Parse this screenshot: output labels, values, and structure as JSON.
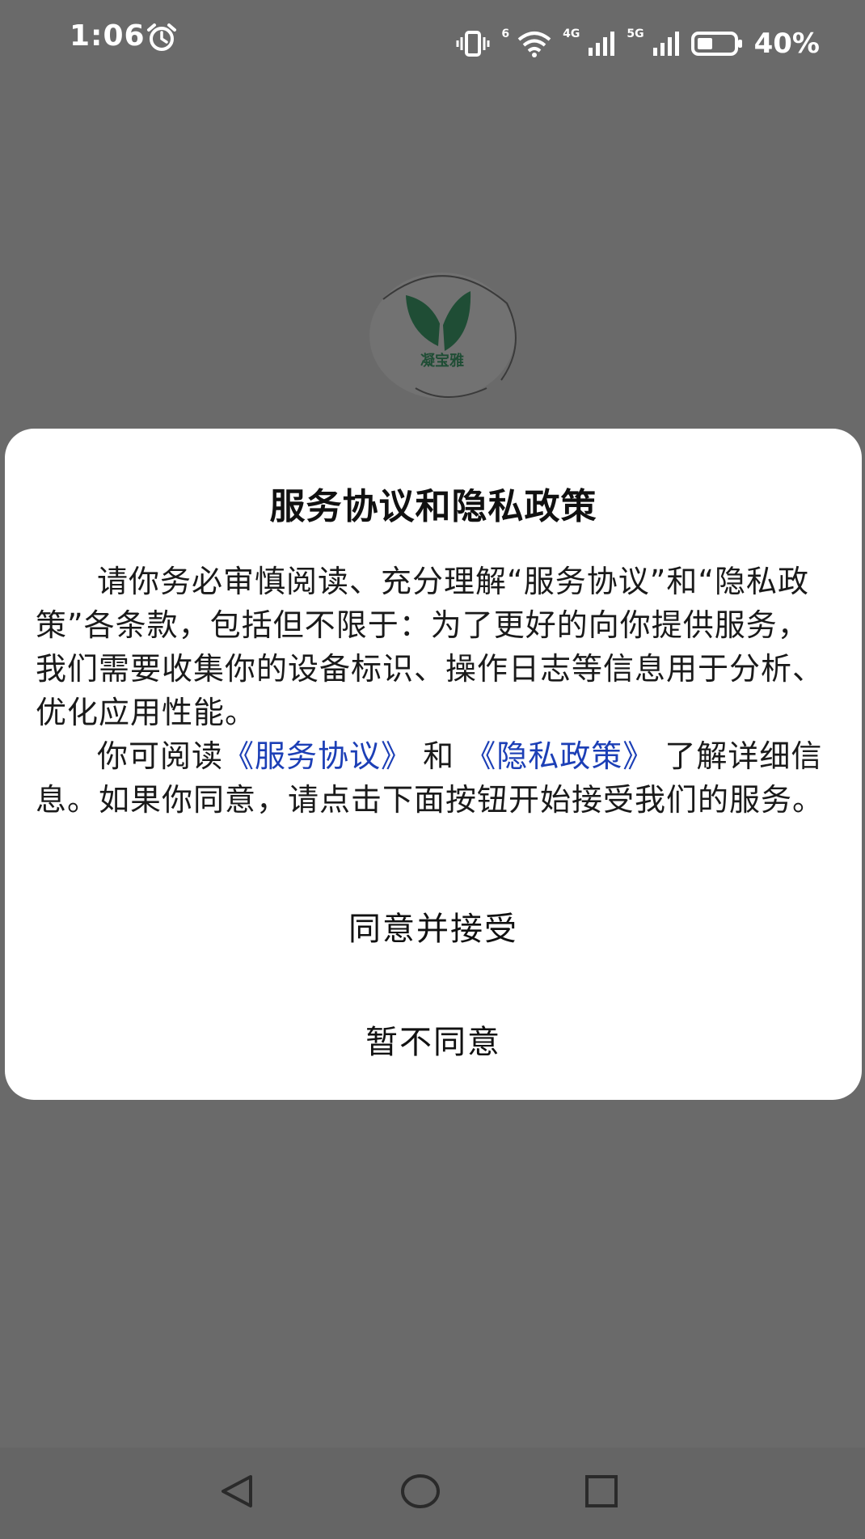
{
  "status_bar": {
    "time": "1:06",
    "network_1": "4G",
    "network_2": "5G",
    "wifi_badge": "6",
    "battery_percent": "40%"
  },
  "app": {
    "logo_text": "凝宝雅",
    "brand_color": "#1f6b45"
  },
  "dialog": {
    "title": "服务协议和隐私政策",
    "paragraph1": "请你务必审慎阅读、充分理解“服务协议”和“隐私政策”各条款，包括但不限于：为了更好的向你提供服务，我们需要收集你的设备标识、操作日志等信息用于分析、优化应用性能。",
    "paragraph2_prefix": "你可阅读",
    "link_service": "《服务协议》",
    "paragraph2_and": "和",
    "link_privacy": "《隐私政策》",
    "paragraph2_suffix": "了解详细信息。如果你同意，请点击下面按钮开始接受我们的服务。",
    "agree_button": "同意并接受",
    "disagree_button": "暂不同意",
    "link_color": "#1c3fb6"
  },
  "nav_bar": {
    "icons": [
      "back-icon",
      "home-icon",
      "recent-apps-icon"
    ]
  }
}
